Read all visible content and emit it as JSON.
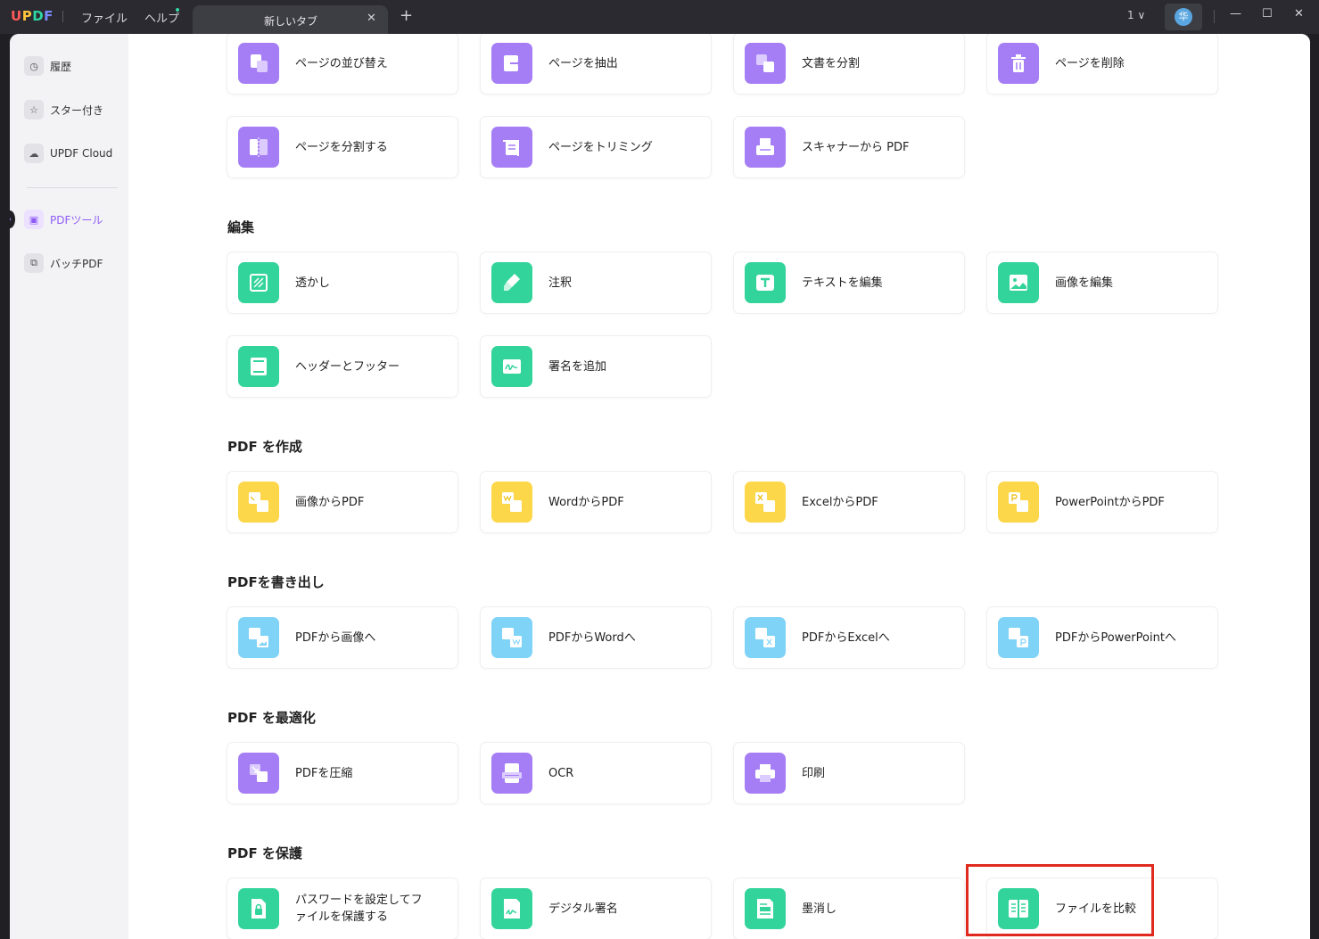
{
  "titlebar": {
    "logo": {
      "u": "U",
      "p": "P",
      "d": "D",
      "f": "F"
    },
    "menu": {
      "file": "ファイル",
      "help": "ヘルプ"
    },
    "tab": {
      "title": "新しいタブ",
      "close": "✕",
      "add": "+"
    },
    "version_count": "1 ∨",
    "avatar_char": "华",
    "window": {
      "minimize": "—",
      "maximize": "☐",
      "close": "✕"
    }
  },
  "sidebar": {
    "items": [
      {
        "label": "履歴",
        "icon": "clock-icon",
        "glyph": "◷"
      },
      {
        "label": "スター付き",
        "icon": "star-icon",
        "glyph": "☆"
      },
      {
        "label": "UPDF Cloud",
        "icon": "cloud-icon",
        "glyph": "☁"
      },
      {
        "label": "PDFツール",
        "icon": "toolbox-icon",
        "glyph": "▣",
        "active": true
      },
      {
        "label": "バッチPDF",
        "icon": "batch-icon",
        "glyph": "⧉"
      }
    ]
  },
  "sections": {
    "page": {
      "cards": [
        "ページの並び替え",
        "ページを抽出",
        "文書を分割",
        "ページを削除",
        "ページを分割する",
        "ページをトリミング",
        "スキャナーから PDF"
      ]
    },
    "edit": {
      "title": "編集",
      "cards": [
        "透かし",
        "注釈",
        "テキストを編集",
        "画像を編集",
        "ヘッダーとフッター",
        "署名を追加"
      ]
    },
    "create": {
      "title": "PDF を作成",
      "cards": [
        "画像からPDF",
        "WordからPDF",
        "ExcelからPDF",
        "PowerPointからPDF"
      ]
    },
    "export": {
      "title": "PDFを書き出し",
      "cards": [
        "PDFから画像へ",
        "PDFからWordへ",
        "PDFからExcelへ",
        "PDFからPowerPointへ"
      ]
    },
    "optimize": {
      "title": "PDF を最適化",
      "cards": [
        "PDFを圧縮",
        "OCR",
        "印刷"
      ]
    },
    "protect": {
      "title": "PDF を保護",
      "cards": [
        "パスワードを設定してファイルを保護する",
        "デジタル署名",
        "墨消し",
        "ファイルを比較"
      ]
    }
  },
  "colors": {
    "purple": "#a57df5",
    "green": "#33d49b",
    "yellow": "#fdd74a",
    "blue": "#7fd3f7",
    "accent": "#8f5cf6",
    "highlight": "#e02a1f"
  }
}
